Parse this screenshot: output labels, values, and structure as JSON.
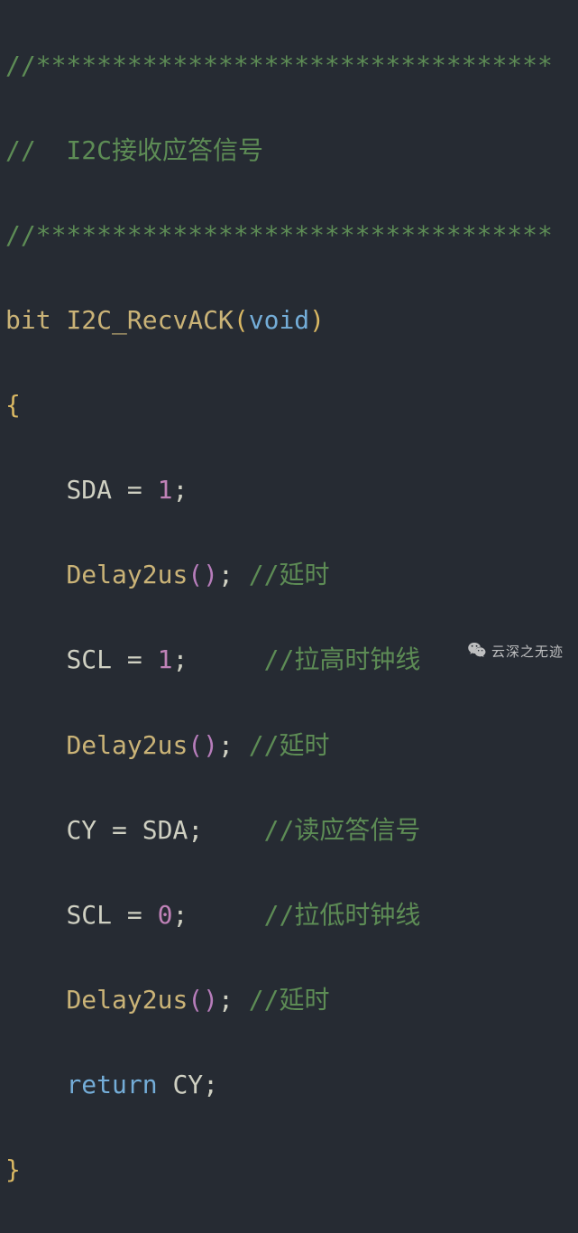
{
  "code": {
    "comment_sep_top": "//**********************************",
    "comment_title": "//  I2C接收应答信号",
    "comment_sep_bot": "//**********************************",
    "fn_ret_type": "bit",
    "fn_name": "I2C_RecvACK",
    "fn_param_type": "void",
    "body": {
      "l1_lhs": "SDA",
      "l1_op": " = ",
      "l1_rhs": "1",
      "l1_semi": ";",
      "l2_fn": "Delay2us",
      "l2_semi": ";",
      "l2_comment": " //延时",
      "l3_lhs": "SCL",
      "l3_op": " = ",
      "l3_rhs": "1",
      "l3_semi": ";",
      "l3_pad": "    ",
      "l3_comment": " //拉高时钟线",
      "l4_fn": "Delay2us",
      "l4_semi": ";",
      "l4_comment": " //延时",
      "l5_lhs": "CY",
      "l5_op": " = ",
      "l5_rhs": "SDA",
      "l5_semi": ";",
      "l5_pad": "   ",
      "l5_comment": " //读应答信号",
      "l6_lhs": "SCL",
      "l6_op": " = ",
      "l6_rhs": "0",
      "l6_semi": ";",
      "l6_pad": "    ",
      "l6_comment": " //拉低时钟线",
      "l7_fn": "Delay2us",
      "l7_semi": ";",
      "l7_comment": " //延时",
      "ret_kw": "return",
      "ret_val": " CY",
      "ret_semi": ";"
    }
  },
  "watermark": {
    "text": "云深之无迹"
  }
}
